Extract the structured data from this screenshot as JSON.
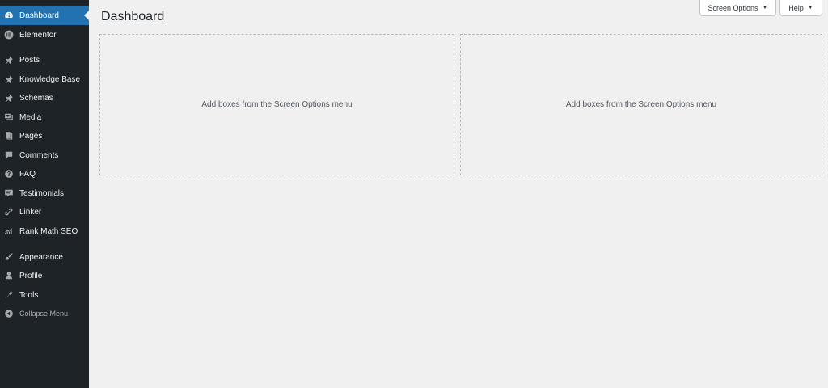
{
  "header": {
    "title": "Dashboard",
    "screen_options_label": "Screen Options",
    "help_label": "Help"
  },
  "sidebar": {
    "items": [
      {
        "label": "Dashboard",
        "icon": "dashboard-icon",
        "active": true
      },
      {
        "label": "Elementor",
        "icon": "elementor-icon"
      },
      {
        "label": "Posts",
        "icon": "pin-icon"
      },
      {
        "label": "Knowledge Base",
        "icon": "pin-icon"
      },
      {
        "label": "Schemas",
        "icon": "pin-icon"
      },
      {
        "label": "Media",
        "icon": "media-icon"
      },
      {
        "label": "Pages",
        "icon": "pages-icon"
      },
      {
        "label": "Comments",
        "icon": "comment-icon"
      },
      {
        "label": "FAQ",
        "icon": "question-icon"
      },
      {
        "label": "Testimonials",
        "icon": "testimonial-icon"
      },
      {
        "label": "Linker",
        "icon": "link-icon"
      },
      {
        "label": "Rank Math SEO",
        "icon": "chart-icon"
      },
      {
        "label": "Appearance",
        "icon": "brush-icon"
      },
      {
        "label": "Profile",
        "icon": "user-icon"
      },
      {
        "label": "Tools",
        "icon": "wrench-icon"
      }
    ],
    "collapse_label": "Collapse Menu"
  },
  "main": {
    "dropzones": [
      {
        "text": "Add boxes from the Screen Options menu"
      },
      {
        "text": "Add boxes from the Screen Options menu"
      }
    ]
  },
  "colors": {
    "sidebar_bg": "#1d2327",
    "active_bg": "#2271b1",
    "page_bg": "#f0f0f1"
  }
}
